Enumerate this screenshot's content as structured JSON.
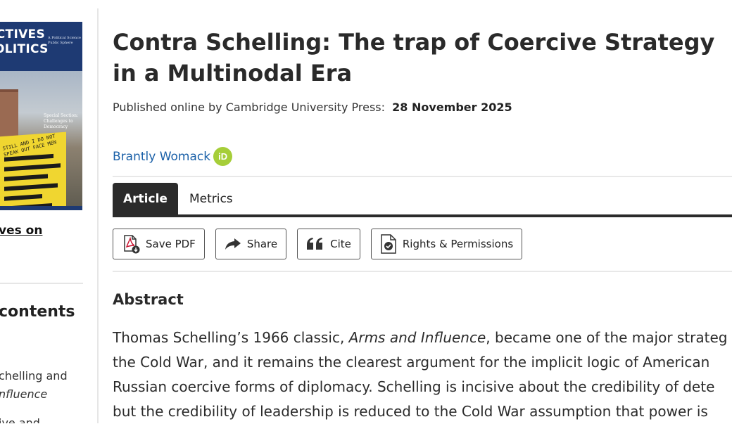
{
  "sidebar": {
    "cover": {
      "title_line1": "CTIVES",
      "title_line2": "OLITICS",
      "tagline": "A Political Science Public Sphere",
      "special_section": "Special Section: Challenges to Democracy",
      "sign_text": "STILL AND I DO NOT SPEAK OUT FACE MEN",
      "footer": "VOLUME 23 · NUMBER 3"
    },
    "journal_link": "ves on",
    "toc_heading": "contents",
    "toc_items": [
      {
        "line1": "chelling and",
        "line2_em": "nfluence"
      },
      {
        "line1": "ive and"
      }
    ]
  },
  "article": {
    "title": "Contra Schelling: The trap of Coercive Strategy in a Multinodal Era",
    "published_prefix": "Published online by Cambridge University Press:",
    "published_date": "28 November 2025",
    "author": "Brantly Womack",
    "orcid_label": "iD"
  },
  "tabs": [
    {
      "label": "Article",
      "active": true
    },
    {
      "label": "Metrics",
      "active": false
    }
  ],
  "toolbar": {
    "save_pdf": "Save PDF",
    "share": "Share",
    "cite": "Cite",
    "rights": "Rights & Permissions"
  },
  "abstract": {
    "heading": "Abstract",
    "line1_pre": "Thomas Schelling’s 1966 classic, ",
    "line1_em": "Arms and Influence",
    "line1_post": ", became one of the major strateg",
    "line2": "the Cold War, and it remains the clearest argument for the implicit logic of American",
    "line3": "Russian coercive forms of diplomacy. Schelling is incisive about the credibility of dete",
    "line4": "but the credibility of leadership is reduced to the Cold War assumption that power is"
  },
  "colors": {
    "link": "#1a60a8",
    "orcid": "#a6ce39",
    "tab_active": "#2b2b2b"
  }
}
